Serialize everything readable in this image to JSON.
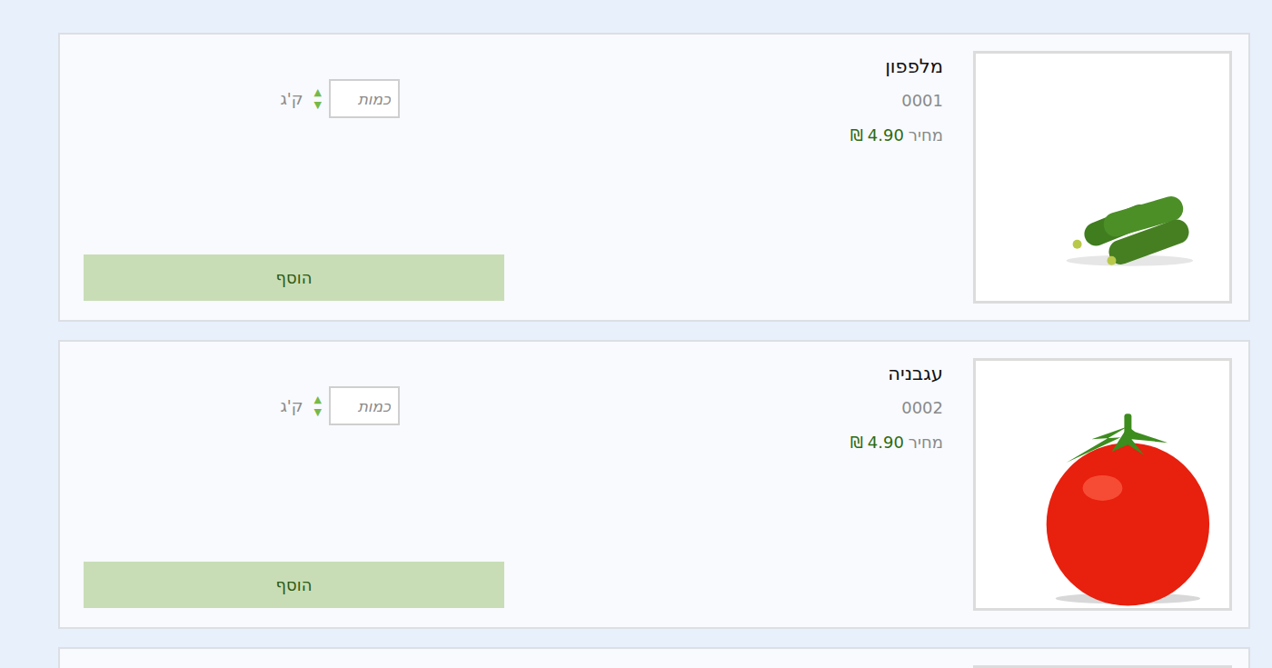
{
  "products": [
    {
      "name": "מלפפון",
      "code": "0001",
      "price": "4.90"
    },
    {
      "name": "עגבניה",
      "code": "0002",
      "price": "4.90"
    },
    {
      "name": "",
      "code": "",
      "price": ""
    }
  ],
  "labels": {
    "price": "מחיר",
    "currency": "₪",
    "quantity_placeholder": "כמות",
    "unit": "ק'ג",
    "spin_up": "▲",
    "spin_down": "▼",
    "add": "הוסף"
  }
}
